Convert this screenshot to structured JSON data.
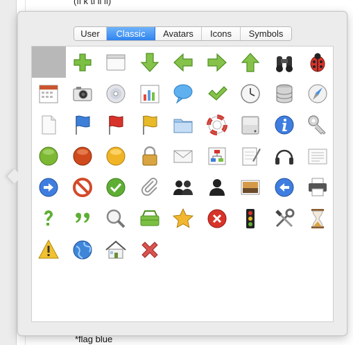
{
  "document": {
    "top_text": "(fi k ti li li)",
    "bottom_text": "*flag blue"
  },
  "tabs": [
    {
      "label": "User",
      "active": false
    },
    {
      "label": "Classic",
      "active": true
    },
    {
      "label": "Avatars",
      "active": false
    },
    {
      "label": "Icons",
      "active": false
    },
    {
      "label": "Symbols",
      "active": false
    }
  ],
  "icons": [
    "blank-selected-icon",
    "plus-icon",
    "window-icon",
    "arrow-down-icon",
    "arrow-left-icon",
    "arrow-right-icon",
    "arrow-up-icon",
    "binoculars-icon",
    "ladybug-icon",
    "calendar-icon",
    "camera-icon",
    "cd-icon",
    "chart-icon",
    "speech-bubble-icon",
    "checkmark-icon",
    "clock-icon",
    "database-icon",
    "compass-icon",
    "document-icon",
    "flag-blue-icon",
    "flag-red-icon",
    "flag-yellow-icon",
    "folder-icon",
    "lifebuoy-icon",
    "harddisk-icon",
    "info-icon",
    "key-icon",
    "bullet-green-icon",
    "bullet-red-icon",
    "bullet-yellow-icon",
    "lock-icon",
    "mail-icon",
    "network-icon",
    "notepad-icon",
    "headphones-icon",
    "notes-icon",
    "arrow-right-circle-icon",
    "no-entry-icon",
    "ok-circle-icon",
    "paperclip-icon",
    "users-icon",
    "user-icon",
    "photo-icon",
    "arrow-left-circle-icon",
    "printer-icon",
    "question-icon",
    "quote-icon",
    "magnifier-icon",
    "shopping-basket-icon",
    "star-icon",
    "stop-circle-icon",
    "traffic-light-icon",
    "tools-icon",
    "hourglass-icon",
    "warning-icon",
    "globe-icon",
    "house-icon",
    "delete-x-icon"
  ],
  "colors": {
    "accent": "#2f84ef",
    "popover_bg": "#ececec",
    "selected_cell": "#b8b8b8"
  }
}
